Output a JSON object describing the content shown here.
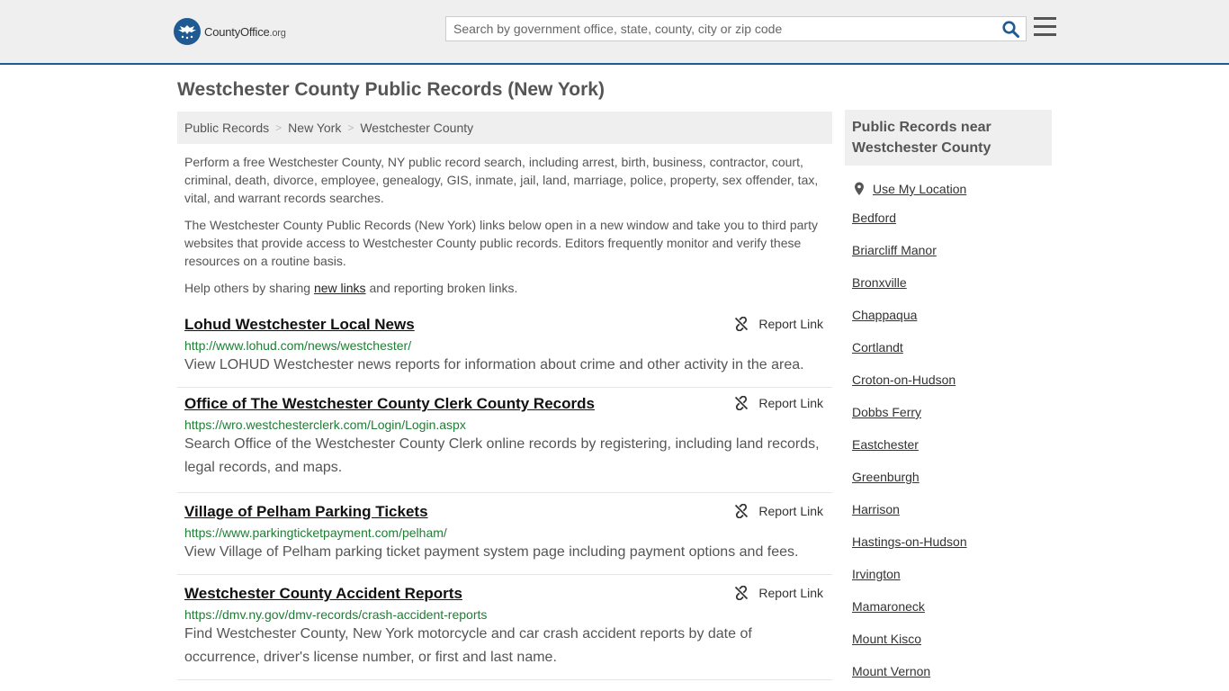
{
  "header": {
    "logo": {
      "name_plain": "County",
      "name_bold": "Office",
      "suffix": ".org"
    },
    "search": {
      "placeholder": "Search by government office, state, county, city or zip code",
      "value": ""
    },
    "accent_color": "#1f5a92"
  },
  "page": {
    "title": "Westchester County Public Records (New York)"
  },
  "breadcrumb": [
    "Public Records",
    "New York",
    "Westchester County"
  ],
  "intro": {
    "p1": "Perform a free Westchester County, NY public record search, including arrest, birth, business, contractor, court, criminal, death, divorce, employee, genealogy, GIS, inmate, jail, land, marriage, police, property, sex offender, tax, vital, and warrant records searches.",
    "p2": "The Westchester County Public Records (New York) links below open in a new window and take you to third party websites that provide access to Westchester County public records. Editors frequently monitor and verify these resources on a routine basis.",
    "p3_before": "Help others by sharing ",
    "p3_link": "new links",
    "p3_after": " and reporting broken links."
  },
  "report_label": "Report Link",
  "links": [
    {
      "title": "Lohud Westchester Local News",
      "url": "http://www.lohud.com/news/westchester/",
      "desc": "View LOHUD Westchester news reports for information about crime and other activity in the area."
    },
    {
      "title": "Office of The Westchester County Clerk County Records",
      "url": "https://wro.westchesterclerk.com/Login/Login.aspx",
      "desc": "Search Office of the Westchester County Clerk online records by registering, including land records, legal records, and maps."
    },
    {
      "title": "Village of Pelham Parking Tickets",
      "url": "https://www.parkingticketpayment.com/pelham/",
      "desc": "View Village of Pelham parking ticket payment system page including payment options and fees."
    },
    {
      "title": "Westchester County Accident Reports",
      "url": "https://dmv.ny.gov/dmv-records/crash-accident-reports",
      "desc": "Find Westchester County, New York motorcycle and car crash accident reports by date of occurrence, driver's license number, or first and last name."
    }
  ],
  "sidebar": {
    "title_line1": "Public Records near",
    "title_line2": "Westchester County",
    "use_location": "Use My Location",
    "places": [
      "Bedford",
      "Briarcliff Manor",
      "Bronxville",
      "Chappaqua",
      "Cortlandt",
      "Croton-on-Hudson",
      "Dobbs Ferry",
      "Eastchester",
      "Greenburgh",
      "Harrison",
      "Hastings-on-Hudson",
      "Irvington",
      "Mamaroneck",
      "Mount Kisco",
      "Mount Vernon"
    ]
  }
}
